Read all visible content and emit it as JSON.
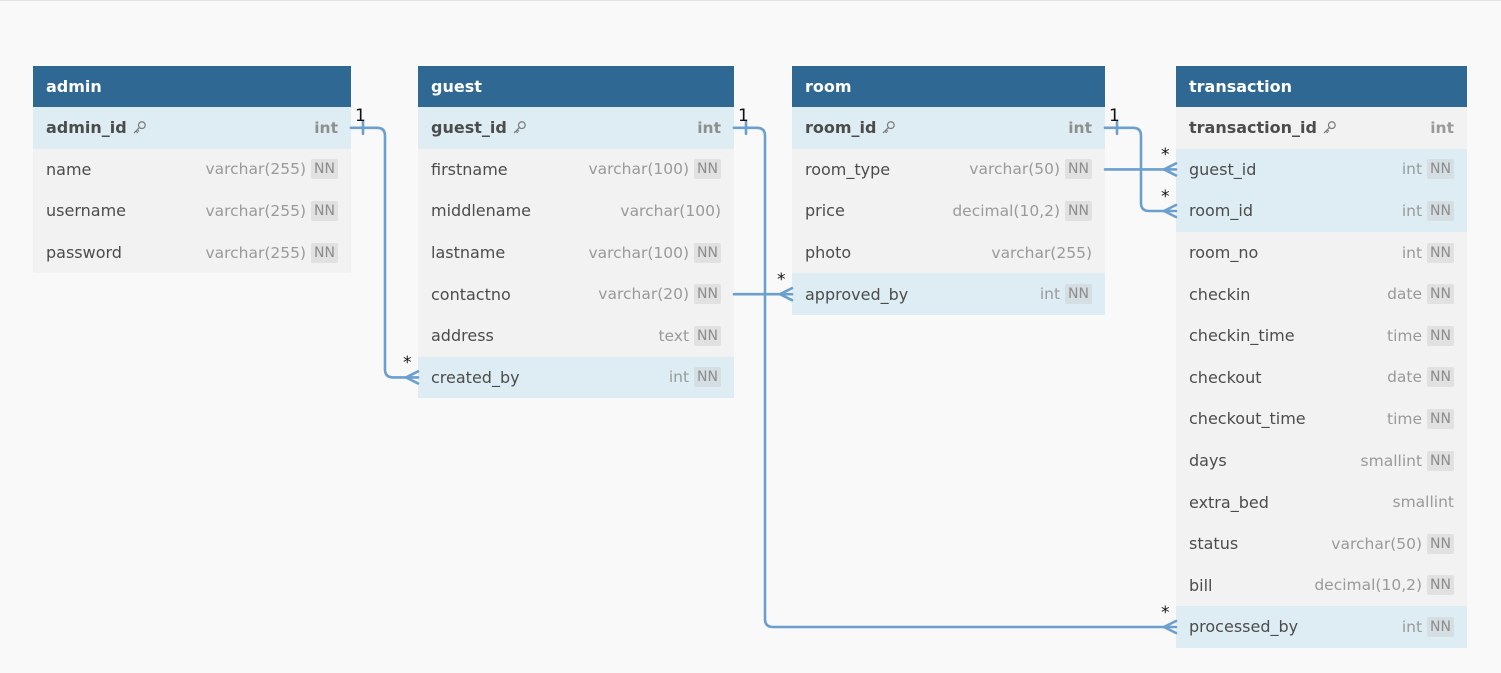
{
  "tables": [
    {
      "id": "admin",
      "name": "admin",
      "fields": [
        {
          "name": "admin_id",
          "type": "int",
          "pk": true,
          "nn": false,
          "highlight": true
        },
        {
          "name": "name",
          "type": "varchar(255)",
          "pk": false,
          "nn": true,
          "highlight": false
        },
        {
          "name": "username",
          "type": "varchar(255)",
          "pk": false,
          "nn": true,
          "highlight": false
        },
        {
          "name": "password",
          "type": "varchar(255)",
          "pk": false,
          "nn": true,
          "highlight": false
        }
      ]
    },
    {
      "id": "guest",
      "name": "guest",
      "fields": [
        {
          "name": "guest_id",
          "type": "int",
          "pk": true,
          "nn": false,
          "highlight": true
        },
        {
          "name": "firstname",
          "type": "varchar(100)",
          "pk": false,
          "nn": true,
          "highlight": false
        },
        {
          "name": "middlename",
          "type": "varchar(100)",
          "pk": false,
          "nn": false,
          "highlight": false
        },
        {
          "name": "lastname",
          "type": "varchar(100)",
          "pk": false,
          "nn": true,
          "highlight": false
        },
        {
          "name": "contactno",
          "type": "varchar(20)",
          "pk": false,
          "nn": true,
          "highlight": false
        },
        {
          "name": "address",
          "type": "text",
          "pk": false,
          "nn": true,
          "highlight": false
        },
        {
          "name": "created_by",
          "type": "int",
          "pk": false,
          "nn": true,
          "highlight": true
        }
      ]
    },
    {
      "id": "room",
      "name": "room",
      "fields": [
        {
          "name": "room_id",
          "type": "int",
          "pk": true,
          "nn": false,
          "highlight": true
        },
        {
          "name": "room_type",
          "type": "varchar(50)",
          "pk": false,
          "nn": true,
          "highlight": false
        },
        {
          "name": "price",
          "type": "decimal(10,2)",
          "pk": false,
          "nn": true,
          "highlight": false
        },
        {
          "name": "photo",
          "type": "varchar(255)",
          "pk": false,
          "nn": false,
          "highlight": false
        },
        {
          "name": "approved_by",
          "type": "int",
          "pk": false,
          "nn": true,
          "highlight": true
        }
      ]
    },
    {
      "id": "transaction",
      "name": "transaction",
      "fields": [
        {
          "name": "transaction_id",
          "type": "int",
          "pk": true,
          "nn": false,
          "highlight": false
        },
        {
          "name": "guest_id",
          "type": "int",
          "pk": false,
          "nn": true,
          "highlight": true
        },
        {
          "name": "room_id",
          "type": "int",
          "pk": false,
          "nn": true,
          "highlight": true
        },
        {
          "name": "room_no",
          "type": "int",
          "pk": false,
          "nn": true,
          "highlight": false
        },
        {
          "name": "checkin",
          "type": "date",
          "pk": false,
          "nn": true,
          "highlight": false
        },
        {
          "name": "checkin_time",
          "type": "time",
          "pk": false,
          "nn": true,
          "highlight": false
        },
        {
          "name": "checkout",
          "type": "date",
          "pk": false,
          "nn": true,
          "highlight": false
        },
        {
          "name": "checkout_time",
          "type": "time",
          "pk": false,
          "nn": true,
          "highlight": false
        },
        {
          "name": "days",
          "type": "smallint",
          "pk": false,
          "nn": true,
          "highlight": false
        },
        {
          "name": "extra_bed",
          "type": "smallint",
          "pk": false,
          "nn": false,
          "highlight": false
        },
        {
          "name": "status",
          "type": "varchar(50)",
          "pk": false,
          "nn": true,
          "highlight": false
        },
        {
          "name": "bill",
          "type": "decimal(10,2)",
          "pk": false,
          "nn": true,
          "highlight": false
        },
        {
          "name": "processed_by",
          "type": "int",
          "pk": false,
          "nn": true,
          "highlight": true
        }
      ]
    }
  ],
  "nn_label": "NN",
  "relations": [
    {
      "from_table": "admin",
      "from_field": "admin_id",
      "from_card": "1",
      "to_table": "guest",
      "to_field": "created_by",
      "to_card": "*"
    },
    {
      "from_table": "guest",
      "from_field": "guest_id",
      "from_card": "1",
      "to_table": "transaction",
      "to_field": "processed_by",
      "to_card": "*"
    },
    {
      "from_table": "guest",
      "from_field": "contactno",
      "from_card": "",
      "to_table": "room",
      "to_field": "approved_by",
      "to_card": "*"
    },
    {
      "from_table": "room",
      "from_field": "room_type",
      "from_card": "",
      "to_table": "transaction",
      "to_field": "guest_id",
      "to_card": "*"
    },
    {
      "from_table": "room",
      "from_field": "room_id",
      "from_card": "1",
      "to_table": "transaction",
      "to_field": "room_id",
      "to_card": "*"
    }
  ],
  "colors": {
    "header": "#306894",
    "link": "#6a9fce",
    "row_highlight": "#deedf3",
    "row": "#f2f2f2"
  }
}
